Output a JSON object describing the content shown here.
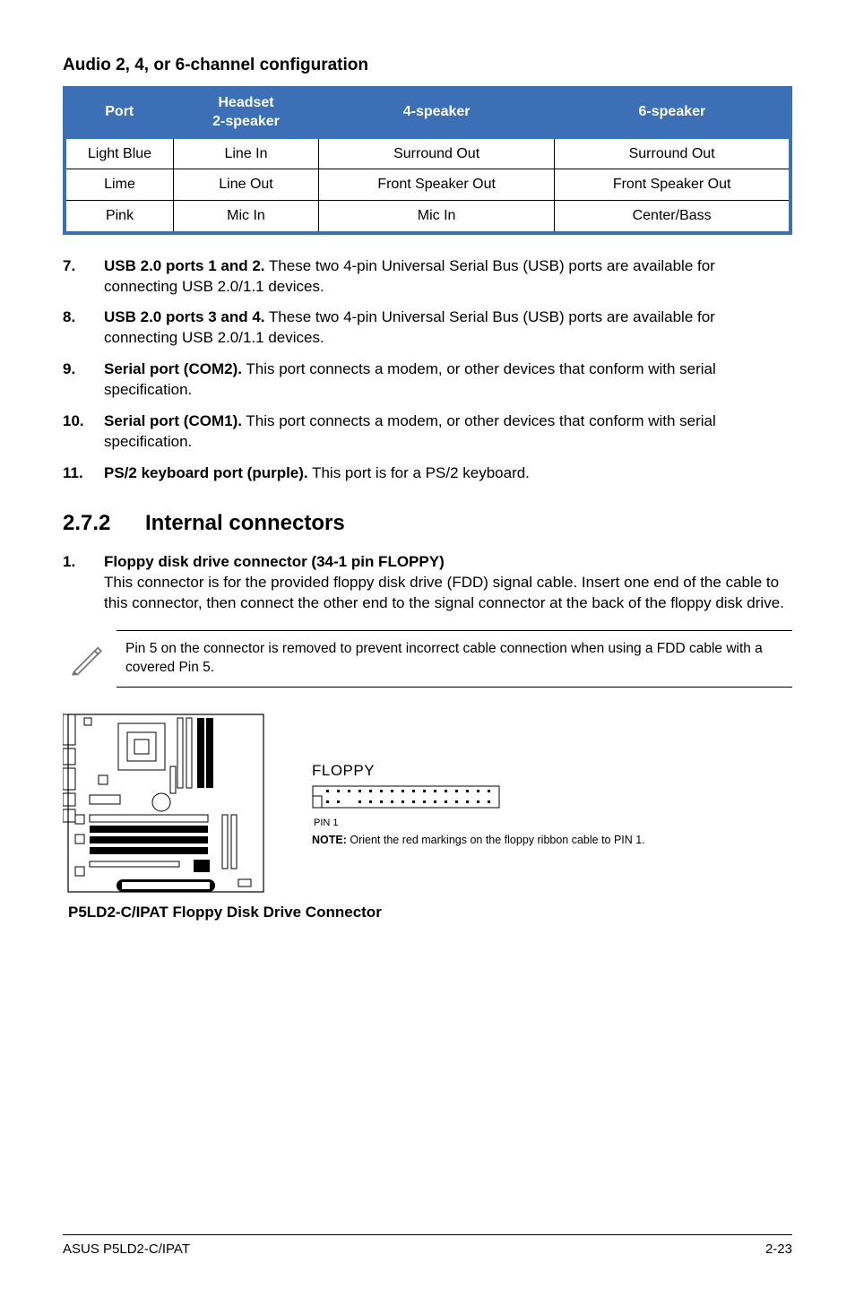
{
  "audio": {
    "title": "Audio 2, 4, or 6-channel configuration",
    "headers": {
      "port": "Port",
      "headset": "Headset\n2-speaker",
      "s4": "4-speaker",
      "s6": "6-speaker"
    },
    "rows": [
      {
        "port": "Light Blue",
        "h": "Line In",
        "s4": "Surround Out",
        "s6": "Surround Out"
      },
      {
        "port": "Lime",
        "h": "Line Out",
        "s4": "Front Speaker Out",
        "s6": "Front Speaker Out"
      },
      {
        "port": "Pink",
        "h": "Mic In",
        "s4": "Mic In",
        "s6": "Center/Bass"
      }
    ]
  },
  "list": [
    {
      "num": "7.",
      "lead": "USB 2.0 ports 1 and 2.",
      "rest": " These two 4-pin Universal Serial Bus (USB) ports are available for connecting USB 2.0/1.1 devices."
    },
    {
      "num": "8.",
      "lead": "USB 2.0 ports 3 and 4.",
      "rest": " These two 4-pin Universal Serial Bus (USB) ports are available for connecting USB 2.0/1.1 devices."
    },
    {
      "num": "9.",
      "lead": "Serial port (COM2).",
      "rest": " This port connects a modem, or other devices that conform with serial specification."
    },
    {
      "num": "10.",
      "lead": "Serial port (COM1).",
      "rest": " This port connects a modem, or other devices that conform with serial specification."
    },
    {
      "num": "11.",
      "lead": "PS/2 keyboard port (purple).",
      "rest": " This port is for a PS/2 keyboard."
    }
  ],
  "subsection": {
    "num": "2.7.2",
    "title": "Internal connectors"
  },
  "floppy_item": {
    "num": "1.",
    "lead": "Floppy disk drive connector (34-1 pin FLOPPY)",
    "body": "This connector is for the provided floppy disk drive (FDD) signal cable. Insert one end of the cable to this connector, then connect the other end to the signal connector at the back of the floppy disk drive."
  },
  "note": "Pin 5 on the connector is removed to prevent incorrect cable connection when using a FDD cable with a covered Pin 5.",
  "diagram": {
    "floppy_label": "FLOPPY",
    "pin1": "PIN 1",
    "note_lead": "NOTE:",
    "note_rest": " Orient the red markings on the floppy ribbon cable to PIN 1.",
    "caption": "P5LD2-C/IPAT Floppy Disk Drive Connector"
  },
  "footer": {
    "left": "ASUS P5LD2-C/IPAT",
    "right": "2-23"
  }
}
